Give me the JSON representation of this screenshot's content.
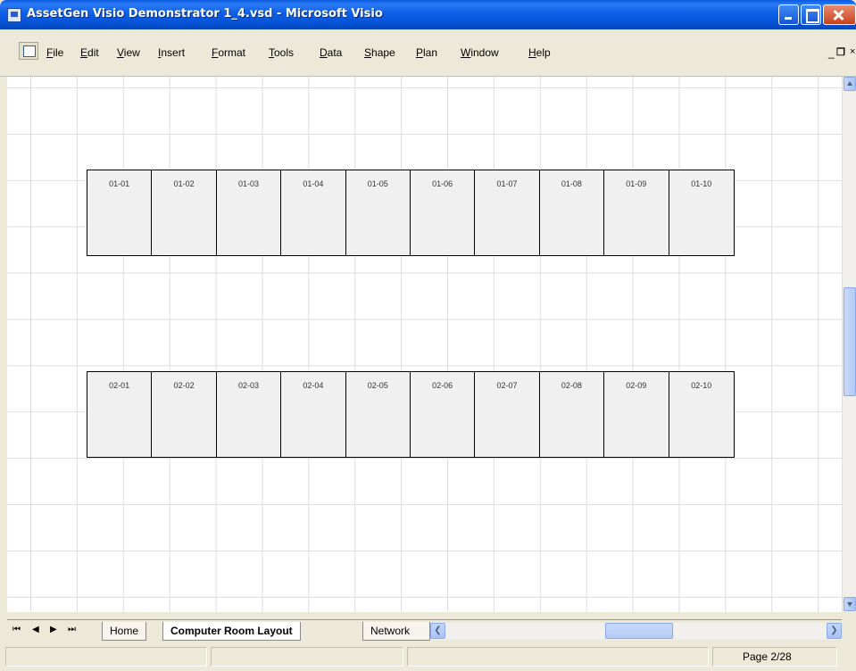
{
  "window": {
    "title": "AssetGen Visio Demonstrator 1_4.vsd - Microsoft Visio"
  },
  "menu": {
    "items": [
      "File",
      "Edit",
      "View",
      "Insert",
      "Format",
      "Tools",
      "Data",
      "Shape",
      "Plan",
      "Window",
      "Help"
    ],
    "doc_close_glyph": "×"
  },
  "diagram": {
    "row1": [
      "01-01",
      "01-02",
      "01-03",
      "01-04",
      "01-05",
      "01-06",
      "01-07",
      "01-08",
      "01-09",
      "01-10"
    ],
    "row2": [
      "02-01",
      "02-02",
      "02-03",
      "02-04",
      "02-05",
      "02-06",
      "02-07",
      "02-08",
      "02-09",
      "02-10"
    ]
  },
  "tabs": {
    "items": [
      "Home",
      "Computer Room Layout",
      "Network"
    ],
    "active_index": 1
  },
  "status": {
    "page": "Page 2/28"
  },
  "colors": {
    "titlebar": "#0a5ae0",
    "canvas": "#ffffff",
    "rack_fill": "#f0f0f0",
    "grid": "#dcdcdc"
  }
}
